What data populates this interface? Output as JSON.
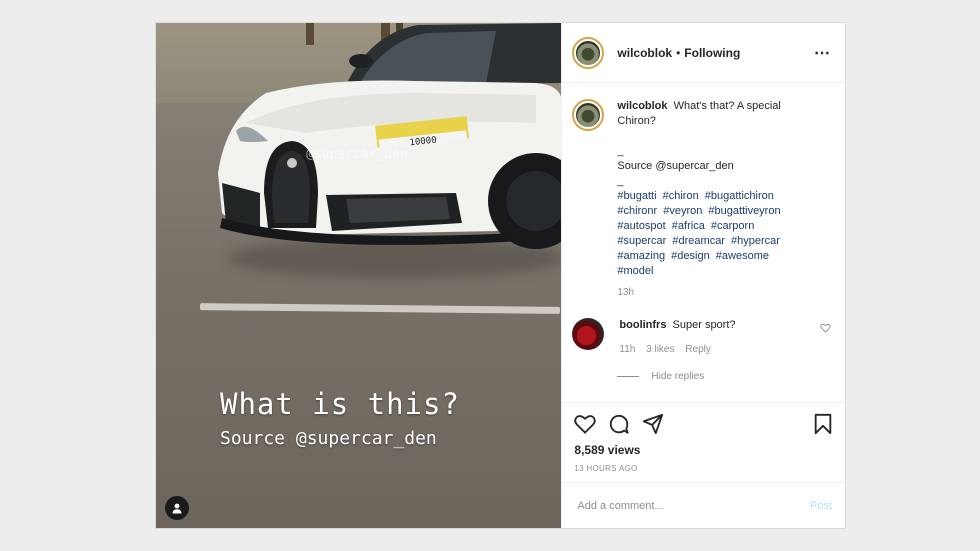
{
  "post": {
    "username": "wilcoblok",
    "follow_status": "Following",
    "dot": "•",
    "more_icon": "⋯",
    "media": {
      "overlay_title": "What is this?",
      "overlay_source": "Source @supercar_den",
      "watermark": "@supercar_den",
      "plate_text": "10000",
      "user_tag_icon": "user-icon"
    },
    "caption": {
      "username": "wilcoblok",
      "text": "What's that? A special Chiron?",
      "dash": "_",
      "source": "Source @supercar_den",
      "dash2": "_",
      "hashtags": [
        "#bugatti",
        "#chiron",
        "#bugattichiron",
        "#chironr",
        "#veyron",
        "#bugattiveyron",
        "#autospot",
        "#africa",
        "#carporn",
        "#supercar",
        "#dreamcar",
        "#hypercar",
        "#amazing",
        "#design",
        "#awesome",
        "#model"
      ],
      "time": "13h"
    },
    "reply": {
      "username": "boolinfrs",
      "text": "Super sport?",
      "time": "11h",
      "likes": "3 likes",
      "reply_label": "Reply",
      "hide_replies": "Hide replies"
    },
    "actions": {
      "views": "8,589 views",
      "posted": "13 HOURS AGO"
    },
    "add_comment": {
      "placeholder": "Add a comment...",
      "post_label": "Post"
    }
  },
  "colors": {
    "link_blue": "#1b3d6d",
    "muted": "#8e8e8e",
    "post_button": "#b2dffc",
    "story_ring": "#d6a54a"
  }
}
